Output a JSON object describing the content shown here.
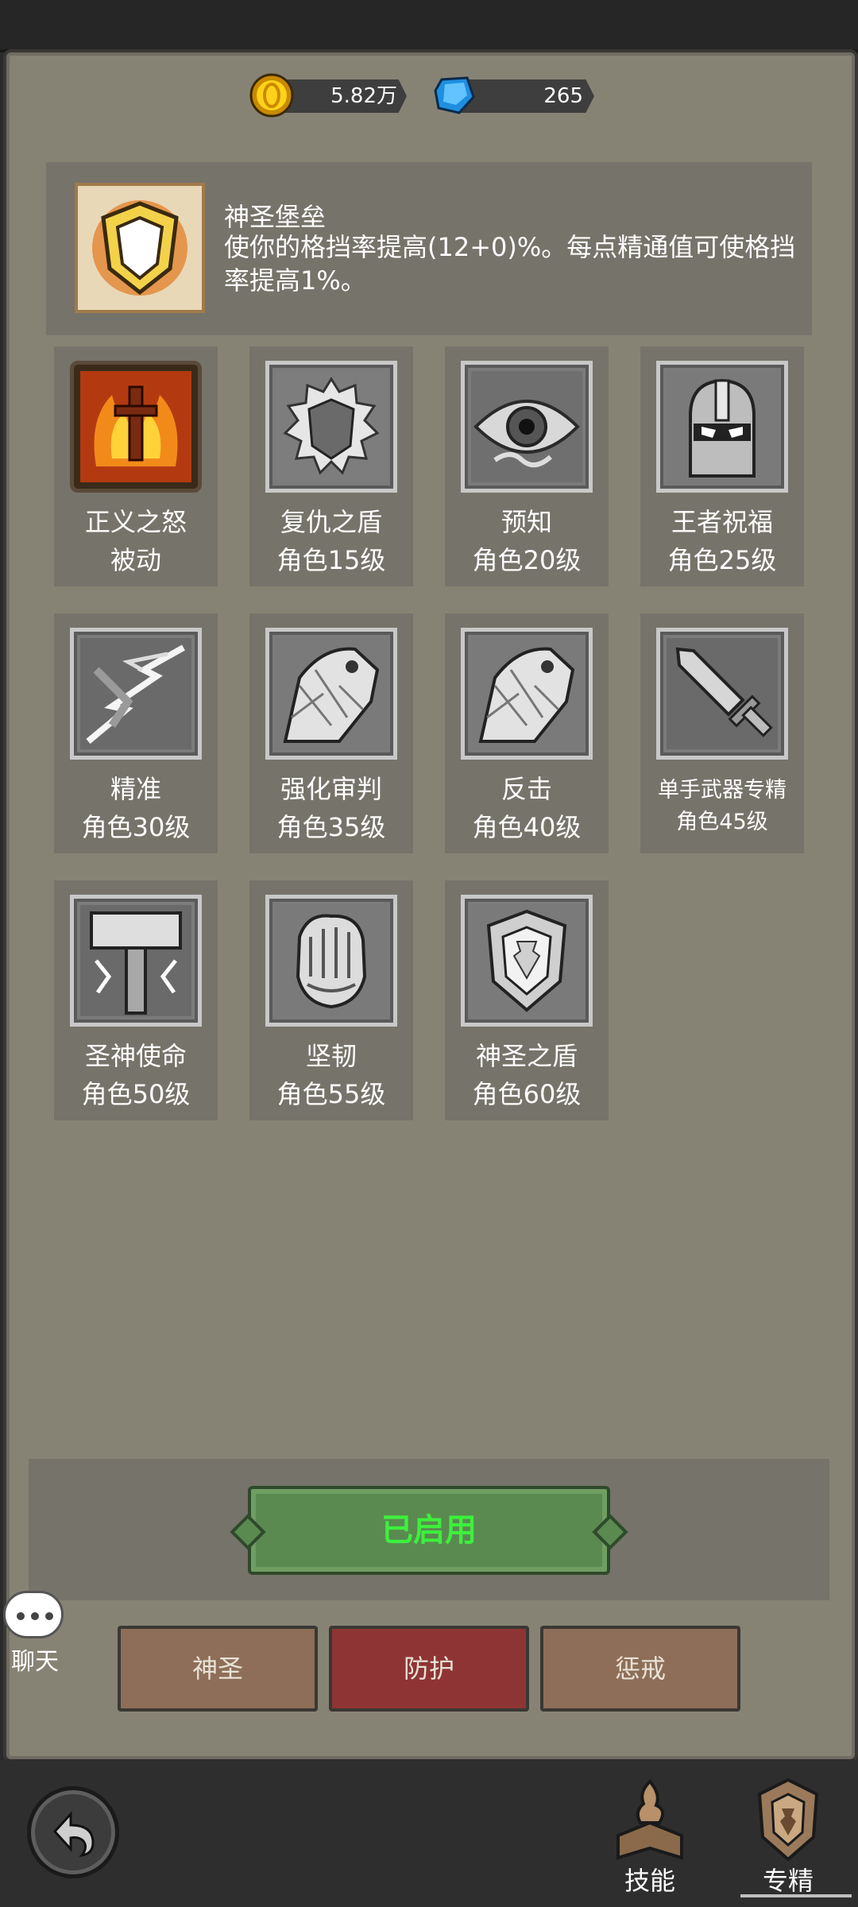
{
  "currency": {
    "gold": "5.82万",
    "gems": "265"
  },
  "selected_skill": {
    "title": "神圣堡垒",
    "description": "使你的格挡率提高(12+0)%。每点精通值可使格挡率提高1%。"
  },
  "skills": [
    {
      "name": "正义之怒",
      "requirement": "被动",
      "icon": "flaming-sword-icon",
      "unlocked": true
    },
    {
      "name": "复仇之盾",
      "requirement": "角色15级",
      "icon": "spiked-shield-icon",
      "unlocked": false
    },
    {
      "name": "预知",
      "requirement": "角色20级",
      "icon": "eye-icon",
      "unlocked": false
    },
    {
      "name": "王者祝福",
      "requirement": "角色25级",
      "icon": "knight-helmet-icon",
      "unlocked": false
    },
    {
      "name": "精准",
      "requirement": "角色30级",
      "icon": "lightning-strike-icon",
      "unlocked": false
    },
    {
      "name": "强化审判",
      "requirement": "角色35级",
      "icon": "shattered-hand-icon",
      "unlocked": false
    },
    {
      "name": "反击",
      "requirement": "角色40级",
      "icon": "shattered-hand-icon",
      "unlocked": false
    },
    {
      "name": "单手武器专精",
      "requirement": "角色45级",
      "icon": "sword-icon",
      "unlocked": false
    },
    {
      "name": "圣神使命",
      "requirement": "角色50级",
      "icon": "hammer-icon",
      "unlocked": false
    },
    {
      "name": "坚韧",
      "requirement": "角色55级",
      "icon": "gauntlet-icon",
      "unlocked": false
    },
    {
      "name": "神圣之盾",
      "requirement": "角色60级",
      "icon": "shield-icon",
      "unlocked": false
    }
  ],
  "enable_button": "已启用",
  "spec_tabs": [
    {
      "label": "神圣",
      "active": false
    },
    {
      "label": "防护",
      "active": true
    },
    {
      "label": "惩戒",
      "active": false
    }
  ],
  "chat_label": "聊天",
  "bottom_nav": [
    {
      "label": "技能",
      "icon": "skill-book-icon"
    },
    {
      "label": "专精",
      "icon": "specialization-crest-icon",
      "active": true
    }
  ],
  "colors": {
    "panel": "#878374",
    "tile": "#76736a",
    "enabled_text": "#3df03d",
    "active_tab": "#8f3434",
    "inactive_tab": "#8e6e58"
  }
}
